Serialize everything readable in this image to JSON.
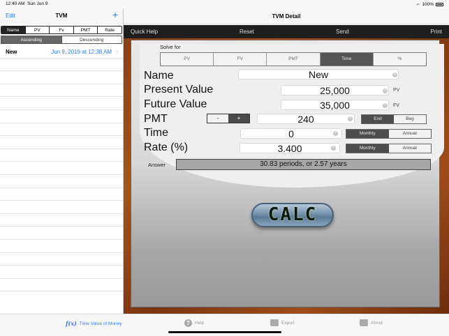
{
  "status": {
    "time": "12:40 AM",
    "date": "Sun Jun 9",
    "battery": "100%"
  },
  "left": {
    "edit": "Edit",
    "title": "TVM",
    "add_icon": "plus-icon",
    "sort_fields": [
      "Name",
      "PV",
      "Fv",
      "PMT",
      "Rate"
    ],
    "sort_selected": "Name",
    "order": [
      "Ascending",
      "Descending"
    ],
    "order_selected": "Ascending",
    "items": [
      {
        "name": "New",
        "date": "Jun 9, 2019 at 12:38 AM"
      }
    ]
  },
  "right": {
    "title": "TVM Detail",
    "toolbar": {
      "quick_help": "Quick Help",
      "reset": "Reset",
      "send": "Send",
      "print": "Print"
    }
  },
  "form": {
    "solve_for_label": "Solve for",
    "solve_options": [
      "PV",
      "FV",
      "PMT",
      "Time",
      "%"
    ],
    "solve_selected": "Time",
    "name_label": "Name",
    "name_value": "New",
    "pv_label": "Present Value",
    "pv_value": "25,000",
    "pv_unit": "PV",
    "fv_label": "Future Value",
    "fv_value": "35,000",
    "fv_unit": "FV",
    "pmt_label": "PMT",
    "pmt_value": "240",
    "minus": "-",
    "plus": "+",
    "pmt_timing": [
      "End",
      "Beg"
    ],
    "pmt_timing_selected": "End",
    "time_label": "Time",
    "time_value": "0",
    "time_period": [
      "Monthly",
      "Annual"
    ],
    "time_period_selected": "Monthly",
    "rate_label": "Rate (%)",
    "rate_value": "3.400",
    "rate_period": [
      "Monthly",
      "Annual"
    ],
    "rate_period_selected": "Monthly",
    "answer_label": "Answer",
    "answer_value": "30.83 periods, or 2.57 years",
    "calc_label": "CALC"
  },
  "tabbar": {
    "app_label": "Time Value of Money",
    "help": "Help",
    "export": "Export",
    "about": "About"
  }
}
